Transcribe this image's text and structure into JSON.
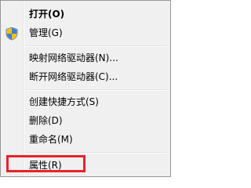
{
  "context_menu": {
    "items": [
      {
        "label": "打开(O)"
      },
      {
        "label": "管理(G)"
      },
      {
        "label": "映射网络驱动器(N)..."
      },
      {
        "label": "断开网络驱动器(C)..."
      },
      {
        "label": "创建快捷方式(S)"
      },
      {
        "label": "删除(D)"
      },
      {
        "label": "重命名(M)"
      },
      {
        "label": "属性(R)"
      }
    ],
    "icons": {
      "manage": "uac-shield-icon"
    },
    "colors": {
      "highlight_border": "#e8222b"
    }
  }
}
